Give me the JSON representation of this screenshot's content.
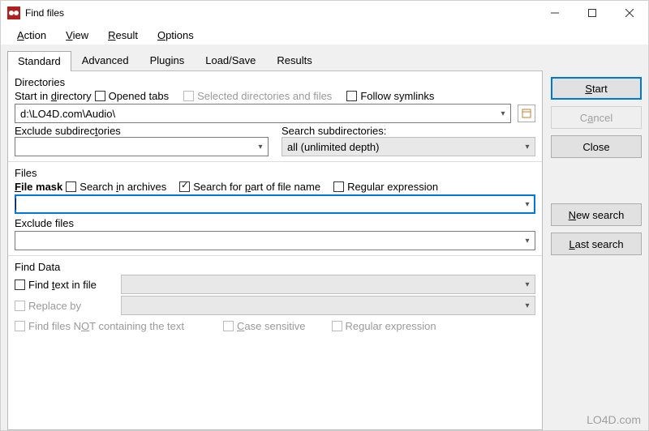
{
  "window": {
    "title": "Find files"
  },
  "menubar": {
    "action": "Action",
    "view": "View",
    "result": "Result",
    "options": "Options"
  },
  "tabs": {
    "standard": "Standard",
    "advanced": "Advanced",
    "plugins": "Plugins",
    "loadsave": "Load/Save",
    "results": "Results"
  },
  "directories": {
    "legend": "Directories",
    "start_in_directory_label": "Start in directory",
    "opened_tabs_label": "Opened tabs",
    "selected_dirs_label": "Selected directories and files",
    "follow_symlinks_label": "Follow symlinks",
    "path_value": "d:\\LO4D.com\\Audio\\",
    "exclude_sub_label": "Exclude subdirectories",
    "exclude_sub_value": "",
    "search_sub_label": "Search subdirectories:",
    "search_sub_value": "all (unlimited depth)"
  },
  "files": {
    "legend": "Files",
    "file_mask_label": "File mask",
    "search_in_archives_label": "Search in archives",
    "search_part_label": "Search for part of file name",
    "regex_label": "Regular expression",
    "file_mask_value": "",
    "exclude_files_label": "Exclude files",
    "exclude_files_value": ""
  },
  "finddata": {
    "legend": "Find Data",
    "find_text_label": "Find text in file",
    "find_text_value": "",
    "replace_by_label": "Replace by",
    "replace_by_value": "",
    "not_containing_label": "Find files NOT containing the text",
    "case_sensitive_label": "Case sensitive",
    "regex_label": "Regular expression"
  },
  "buttons": {
    "start": "Start",
    "cancel": "Cancel",
    "close": "Close",
    "new_search": "New search",
    "last_search": "Last search"
  },
  "watermark": "LO4D.com"
}
